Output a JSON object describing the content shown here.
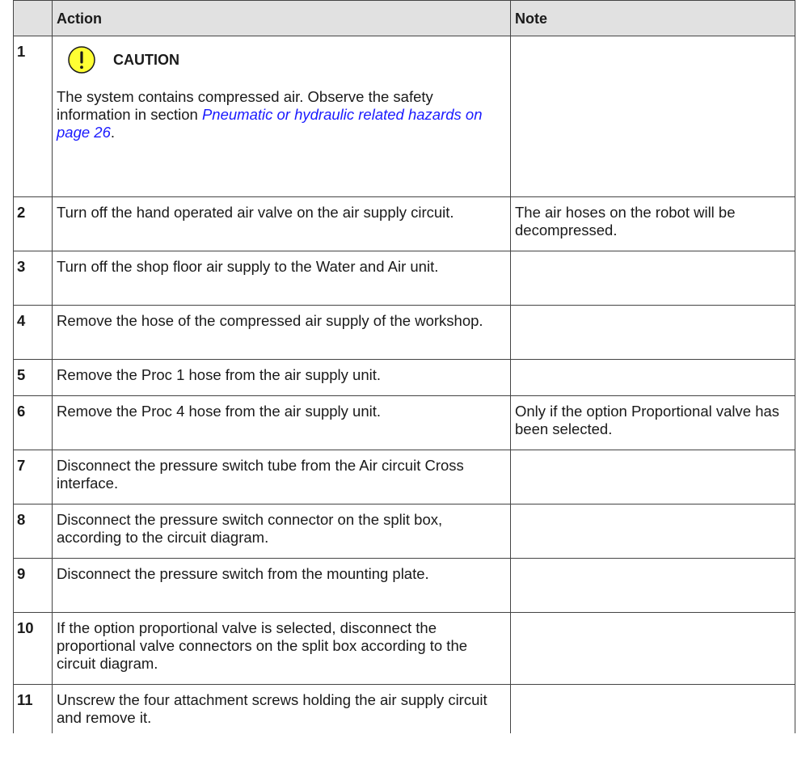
{
  "table": {
    "headers": [
      "",
      "Action",
      "Note"
    ],
    "rows": [
      {
        "step": "1",
        "caution": {
          "label": "CAUTION",
          "icon": "caution-exclamation-icon",
          "color": "#ffff33",
          "text_before": "The system contains compressed air. Observe the safety information in section ",
          "link": "Pneumatic or hydraulic related hazards on page 26",
          "text_after": "."
        },
        "note": ""
      },
      {
        "step": "2",
        "action": "Turn off the hand operated air valve on the air supply circuit.",
        "note": "The air hoses on the robot will be decompressed."
      },
      {
        "step": "3",
        "action": "Turn off the shop floor air supply to the Water and Air unit.",
        "note": ""
      },
      {
        "step": "4",
        "action": "Remove the hose of the compressed air supply of the workshop.",
        "note": ""
      },
      {
        "step": "5",
        "action": "Remove the Proc 1 hose from the air supply unit.",
        "note": ""
      },
      {
        "step": "6",
        "action": "Remove the Proc 4 hose from the air supply unit.",
        "note": "Only if the option Proportional valve has been selected."
      },
      {
        "step": "7",
        "action": "Disconnect the pressure switch tube from the Air circuit Cross interface.",
        "note": ""
      },
      {
        "step": "8",
        "action": "Disconnect the pressure switch connector on the split box, according to the circuit diagram.",
        "note": ""
      },
      {
        "step": "9",
        "action": "Disconnect the pressure switch from the mounting plate.",
        "note": ""
      },
      {
        "step": "10",
        "action": "If the option proportional valve is selected, disconnect the proportional valve connectors on the split box according to the circuit diagram.",
        "note": ""
      },
      {
        "step": "11",
        "action": "Unscrew the four attachment screws holding the air supply circuit and remove it.",
        "note": ""
      }
    ]
  },
  "colors": {
    "header_bg": "#e1e1e1",
    "link": "#1a1aff",
    "border": "#444444"
  }
}
